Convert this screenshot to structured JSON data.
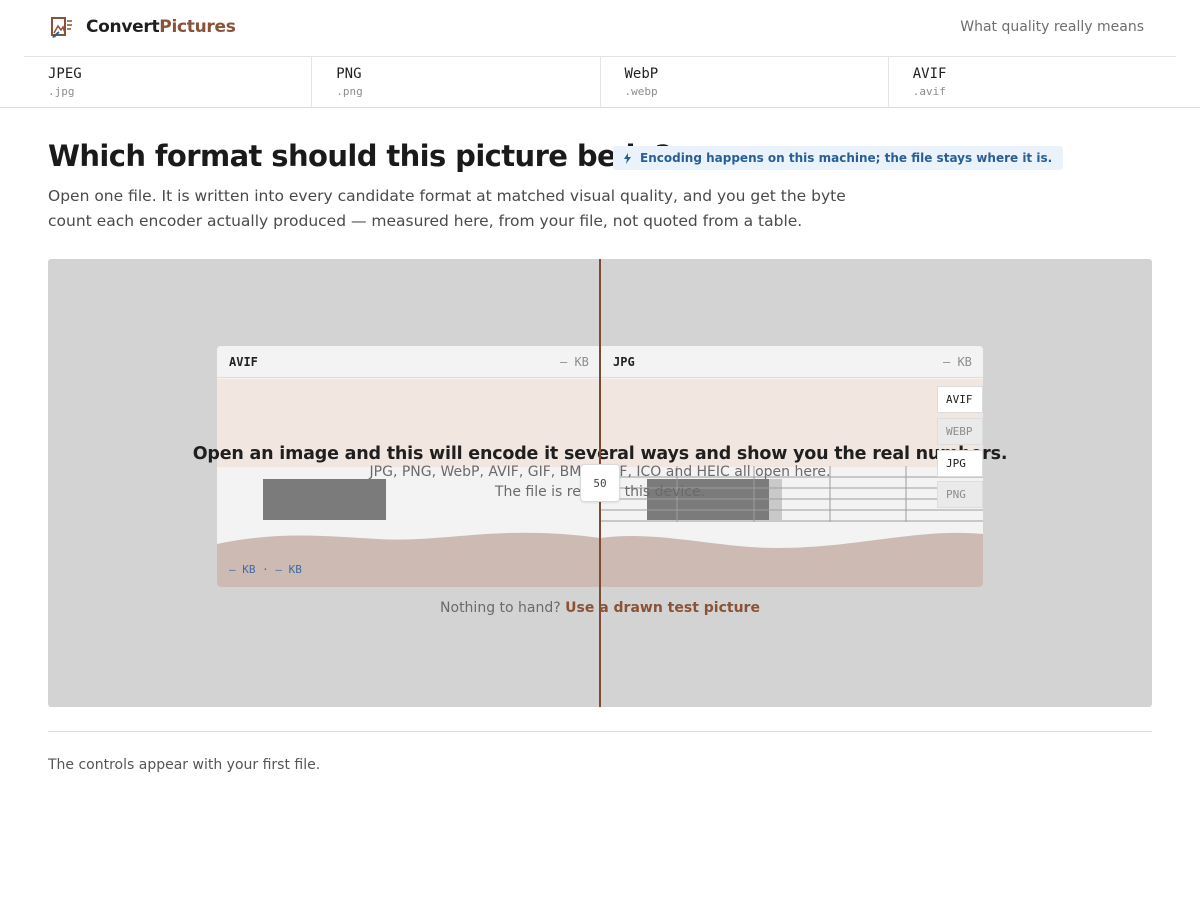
{
  "header": {
    "brand_part1": "Convert",
    "brand_part2": "Pictures",
    "link": "What quality really means"
  },
  "formats": [
    {
      "name": "JPEG",
      "ext": ".jpg"
    },
    {
      "name": "PNG",
      "ext": ".png"
    },
    {
      "name": "WebP",
      "ext": ".webp"
    },
    {
      "name": "AVIF",
      "ext": ".avif"
    }
  ],
  "main": {
    "title": "Which format should this picture be in?",
    "badge": "Encoding happens on this machine; the file stays where it is.",
    "intro": "Open one file. It is written into every candidate format at matched visual quality, and you get the byte count each encoder actually produced — measured here, from your file, not quoted from a table."
  },
  "stage": {
    "left_label": "AVIF",
    "left_kb": "— KB",
    "right_label": "JPG",
    "right_kb": "— KB",
    "stats": "— KB · — KB",
    "split": "50",
    "drop_title": "Open an image and this will encode it several ways and show you the real numbers.",
    "drop_sub1": "JPG, PNG, WebP, AVIF, GIF, BMP, TIFF, ICO and HEIC all open here.",
    "drop_sub2": "The file is read on this device.",
    "picker": [
      "AVIF",
      "WEBP",
      "JPG",
      "PNG"
    ],
    "test_prefix": "Nothing to hand?",
    "test_link": "Use a drawn test picture"
  },
  "footer": {
    "note": "The controls appear with your first file."
  },
  "colors": {
    "accent": "#8a5236",
    "badge_bg": "#eaf2fb",
    "badge_text": "#2a5f95",
    "stage_bg": "#d3d3d3"
  }
}
